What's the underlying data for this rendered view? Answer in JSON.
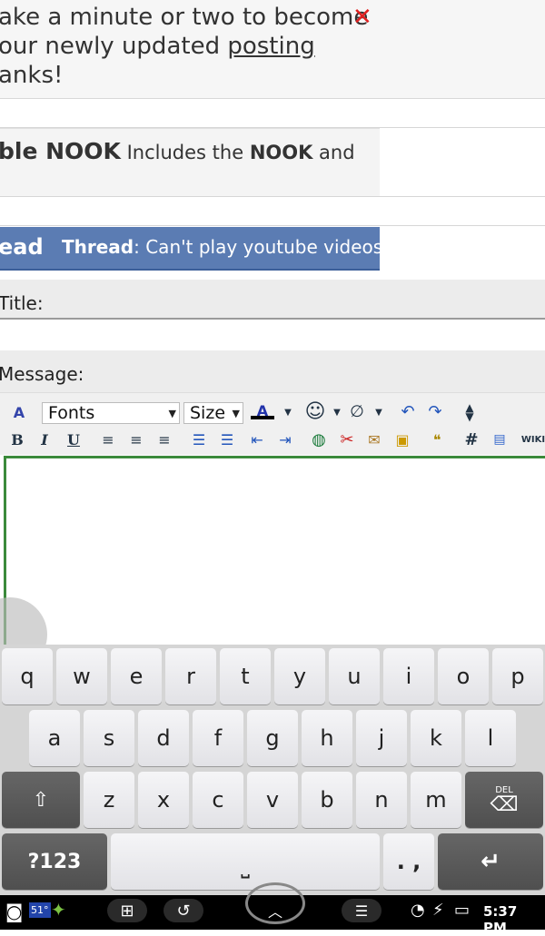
{
  "notice": {
    "line1": "ake a minute or two to become",
    "line2_prefix": "our newly updated ",
    "line2_link": "posting",
    "line3": "anks!",
    "close_symbol": "✕"
  },
  "nook": {
    "bold1": "ble NOOK",
    "mid": " Includes the ",
    "bold2": "NOOK",
    "tail": " and"
  },
  "thread": {
    "lead": "ead",
    "label": "Thread",
    "title": ": Can't play youtube videos"
  },
  "form": {
    "title_label": "Title:",
    "message_label": "Message:"
  },
  "toolbar": {
    "fonts": "Fonts",
    "size": "Size",
    "bold": "B",
    "italic": "I",
    "underline": "U",
    "hash": "#",
    "wiki": "WIKI"
  },
  "keyboard": {
    "row1": [
      "q",
      "w",
      "e",
      "r",
      "t",
      "y",
      "u",
      "i",
      "o",
      "p"
    ],
    "row2": [
      "a",
      "s",
      "d",
      "f",
      "g",
      "h",
      "j",
      "k",
      "l"
    ],
    "row3": [
      "z",
      "x",
      "c",
      "v",
      "b",
      "n",
      "m"
    ],
    "numbers": "?123",
    "punct": ". ,",
    "del": "DEL"
  },
  "status": {
    "temp": "51°",
    "time": "5:37 PM"
  }
}
